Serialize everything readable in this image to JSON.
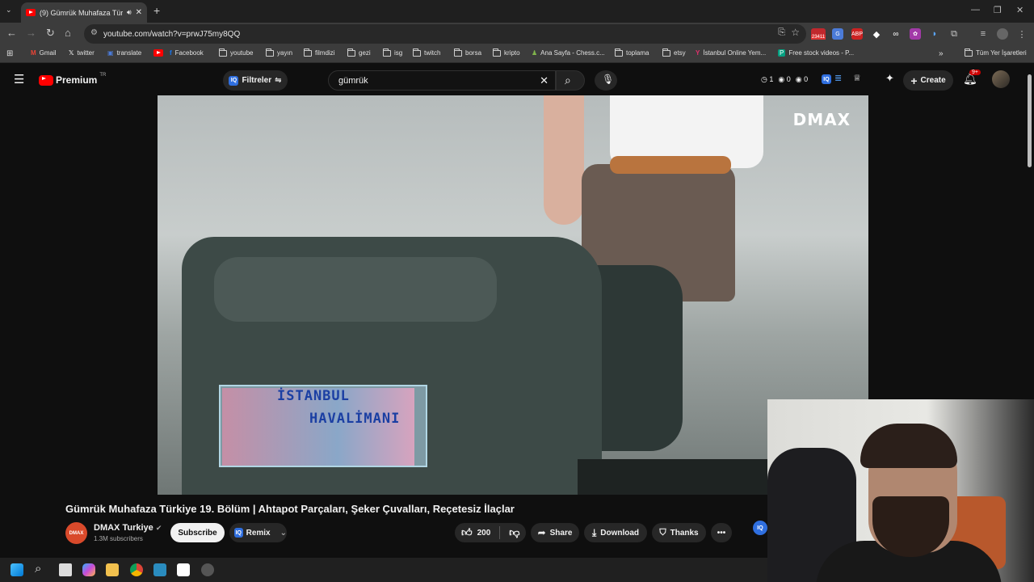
{
  "browser": {
    "tab_title": "(9) Gümrük Muhafaza Türk",
    "url": "youtube.com/watch?v=prwJ75my8QQ",
    "extension_badge": "23411",
    "bookmarks": [
      "Gmail",
      "twitter",
      "translate",
      "Facebook",
      "youtube",
      "yayın",
      "filmdizi",
      "gezi",
      "isg",
      "twitch",
      "borsa",
      "kripto",
      "Ana Sayfa - Chess.c...",
      "toplama",
      "etsy",
      "İstanbul Online Yem...",
      "Free stock videos - P..."
    ],
    "all_bookmarks_label": "Tüm Yer İşaretleri"
  },
  "youtube": {
    "logo_text": "Premium",
    "region": "TR",
    "filters_label": "Filtreler",
    "search_value": "gümrük",
    "header_counts": [
      "1",
      "0",
      "0"
    ],
    "create_label": "Create",
    "notification_badge": "9+"
  },
  "video": {
    "channel_logo": "DMAX",
    "overlay_line1": "İSTANBUL",
    "overlay_line2": "HAVALİMANI",
    "title": "Gümrük Muhafaza Türkiye 19. Bölüm | Ahtapot Parçaları, Şeker Çuvalları, Reçetesiz İlaçlar",
    "channel_name": "DMAX Turkiye",
    "subscribers": "1.3M subscribers",
    "subscribe_label": "Subscribe",
    "remix_label": "Remix",
    "likes": "200",
    "share_label": "Share",
    "download_label": "Download",
    "thanks_label": "Thanks"
  }
}
